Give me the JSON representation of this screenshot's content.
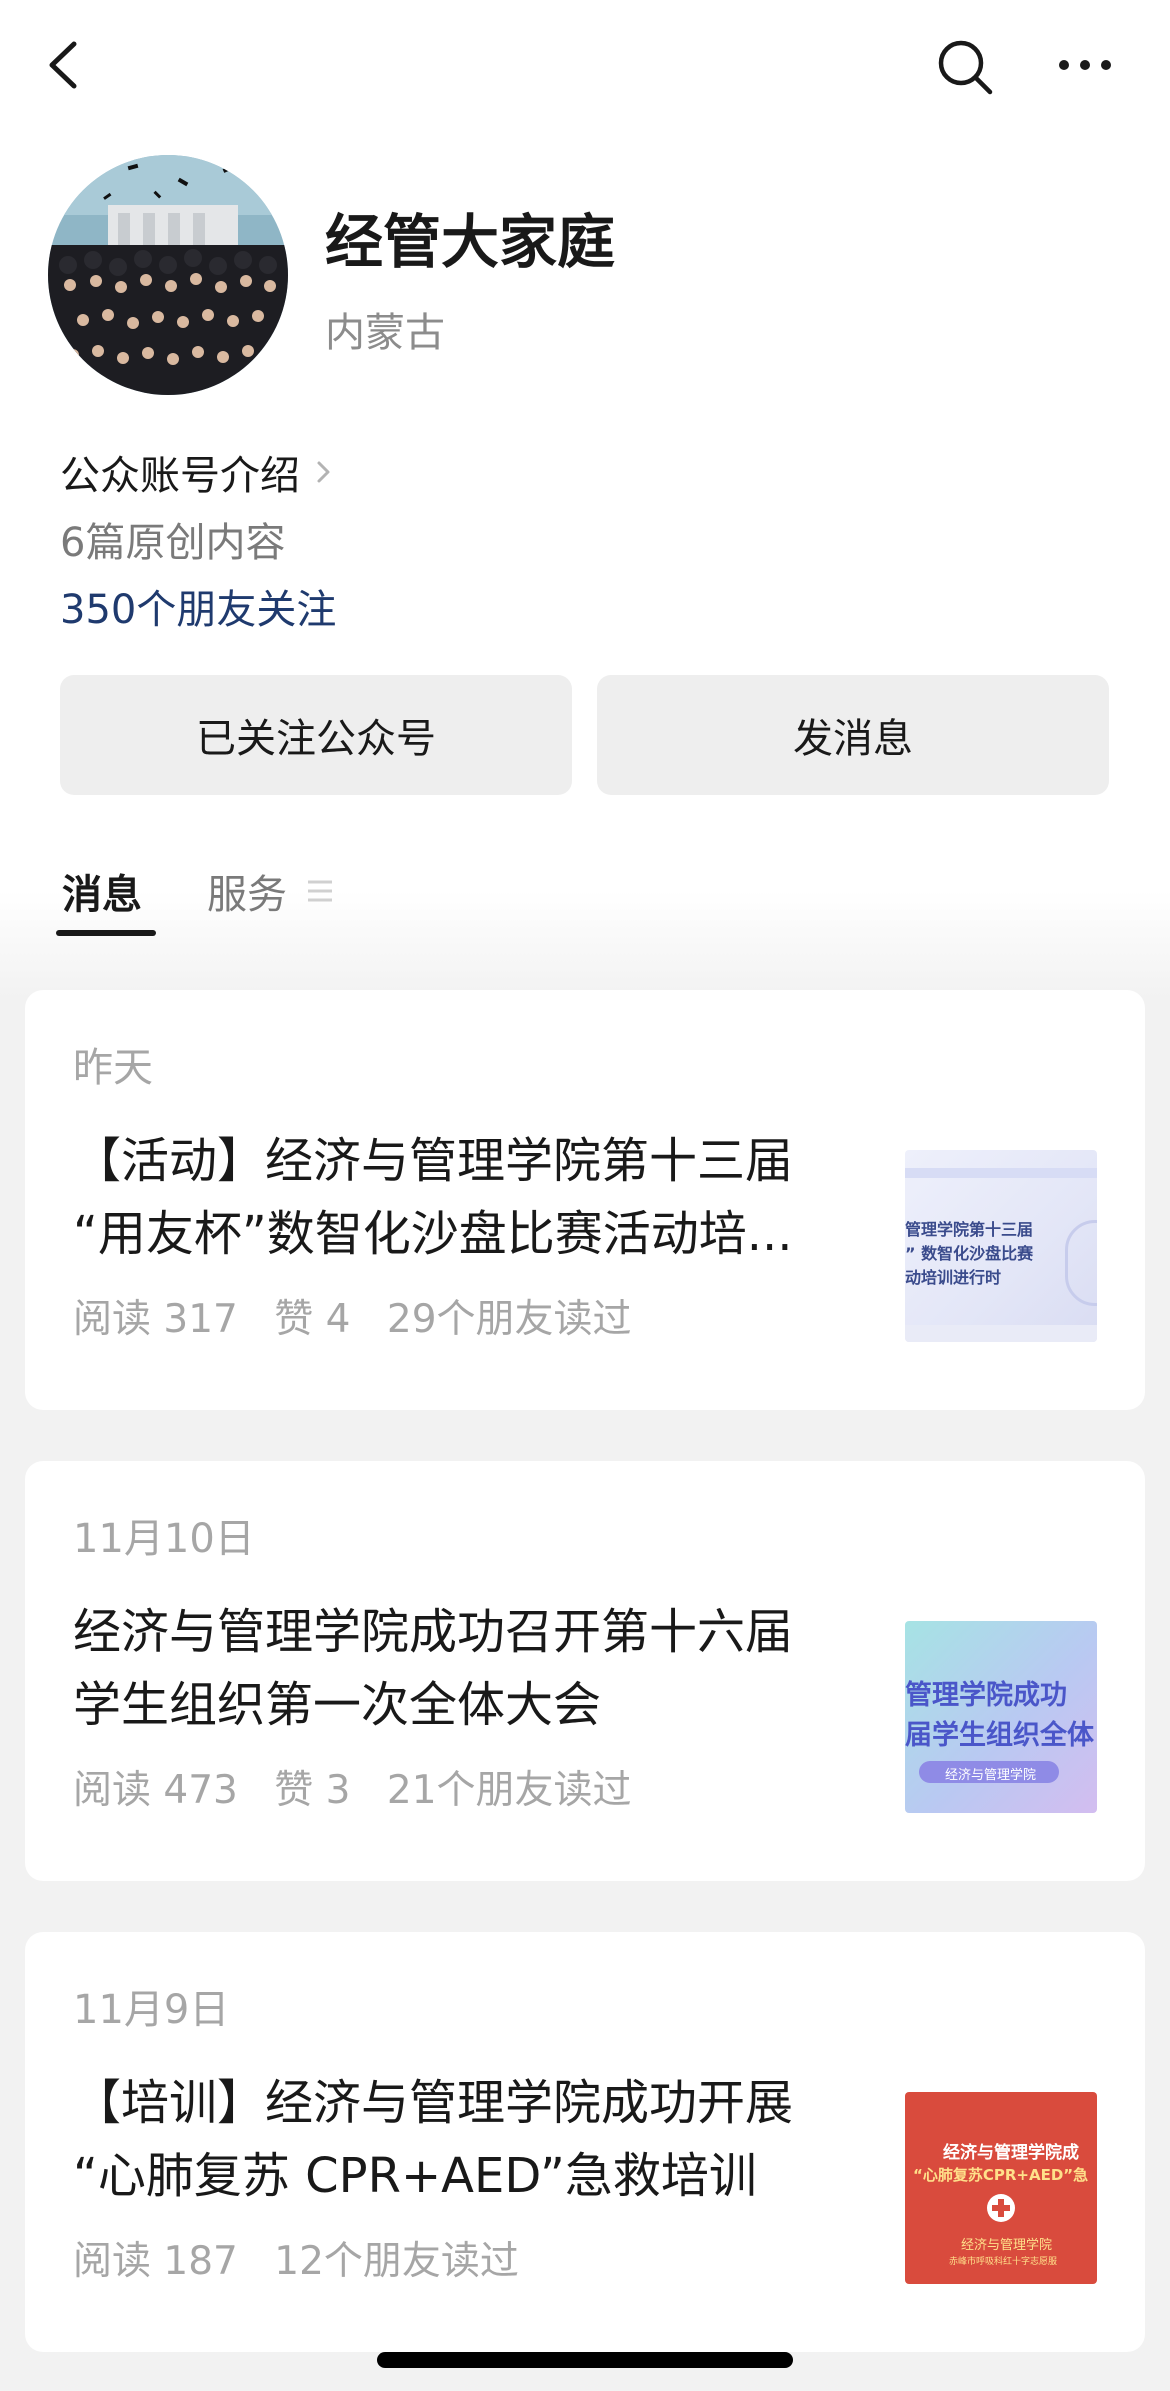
{
  "header": {
    "back_icon": "chevron-left-icon",
    "search_icon": "search-icon",
    "more_icon": "more-horizontal-icon"
  },
  "profile": {
    "name": "经管大家庭",
    "region": "内蒙古",
    "intro_label": "公众账号介绍",
    "original_count": "6篇原创内容",
    "friends_following": "350个朋友关注"
  },
  "actions": {
    "followed_label": "已关注公众号",
    "message_label": "发消息"
  },
  "tabs": [
    {
      "label": "消息",
      "active": true
    },
    {
      "label": "服务",
      "active": false
    }
  ],
  "articles": [
    {
      "date": "昨天",
      "title_lines": [
        "【活动】经济与管理学院第十三届",
        "“用友杯”数智化沙盘比赛活动培..."
      ],
      "stats": [
        "阅读 317",
        "赞 4",
        "29个朋友读过"
      ],
      "thumb_text": [
        "管理学院第十三届",
        "” 数智化沙盘比赛",
        "动培训进行时"
      ]
    },
    {
      "date": "11月10日",
      "title_lines": [
        "经济与管理学院成功召开第十六届",
        "学生组织第一次全体大会"
      ],
      "stats": [
        "阅读 473",
        "赞 3",
        "21个朋友读过"
      ],
      "thumb_text": [
        "管理学院成功",
        "届学生组织全体",
        "经济与管理学院"
      ]
    },
    {
      "date": "11月9日",
      "title_lines": [
        "【培训】经济与管理学院成功开展",
        "“心肺复苏 CPR+AED”急救培训"
      ],
      "stats": [
        "阅读 187",
        "12个朋友读过"
      ],
      "thumb_text": [
        "经济与管理学院成",
        "“心肺复苏CPR+AED”急",
        "经济与管理学院",
        "赤峰市呼吸科红十字志愿服"
      ]
    }
  ],
  "colors": {
    "link_blue": "#1f3a6e",
    "muted_gray": "#a6a6a6",
    "button_bg": "#eeeeee",
    "page_bg": "#f2f2f2"
  }
}
